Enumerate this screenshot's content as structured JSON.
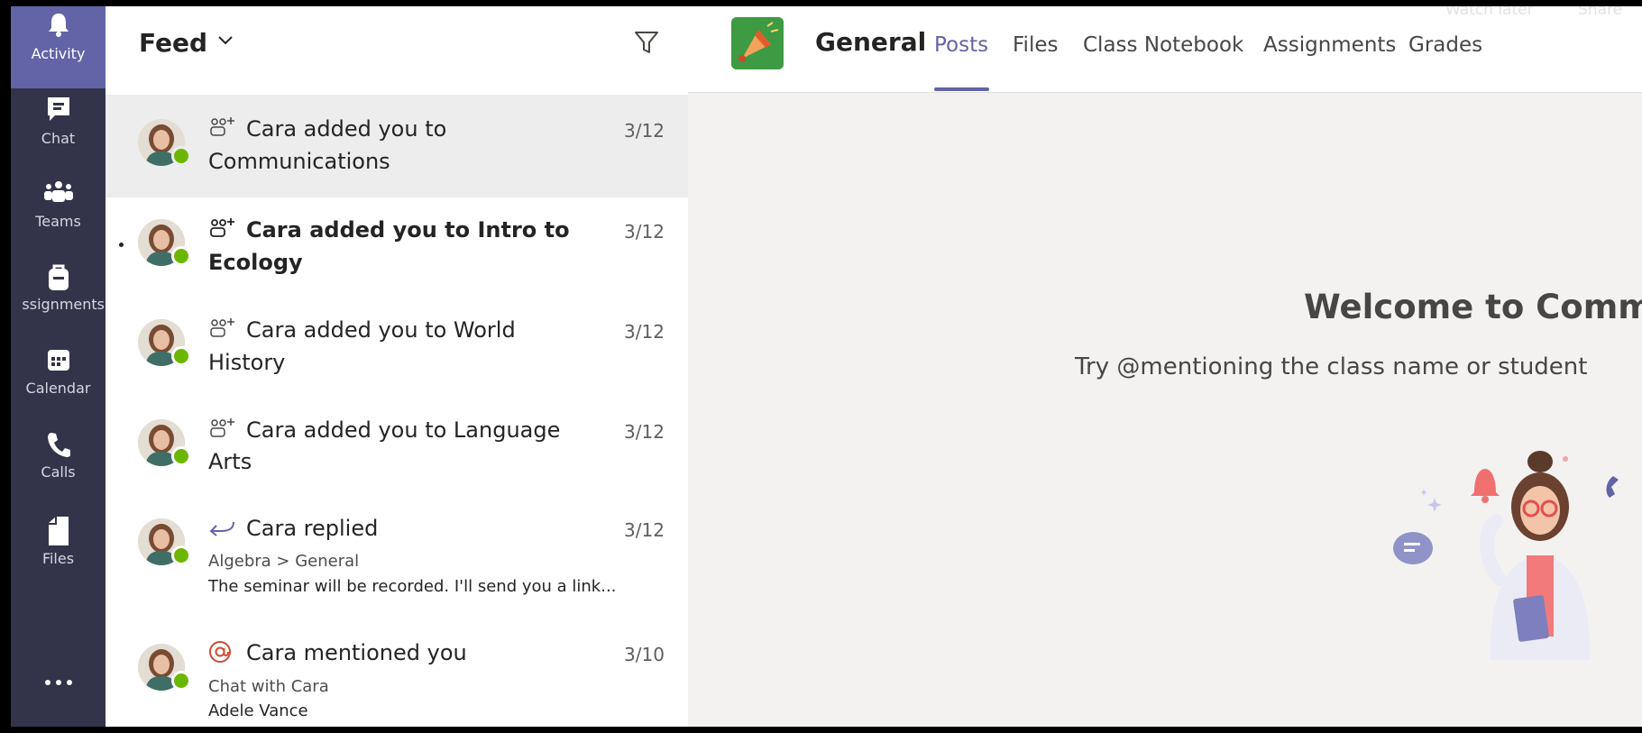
{
  "rail": {
    "items": [
      {
        "label": "Activity",
        "icon": "bell-icon"
      },
      {
        "label": "Chat",
        "icon": "chat-icon"
      },
      {
        "label": "Teams",
        "icon": "teams-icon"
      },
      {
        "label": "ssignments",
        "icon": "assignments-icon"
      },
      {
        "label": "Calendar",
        "icon": "calendar-icon"
      },
      {
        "label": "Calls",
        "icon": "phone-icon"
      },
      {
        "label": "Files",
        "icon": "file-icon"
      },
      {
        "label": "",
        "icon": "more-icon"
      }
    ]
  },
  "feed": {
    "title": "Feed",
    "items": [
      {
        "line1": "Cara added you to",
        "line2": "Communications",
        "date": "3/12"
      },
      {
        "line1": "Cara added you to Intro to",
        "line2": "Ecology",
        "date": "3/12"
      },
      {
        "line1": "Cara added you to World",
        "line2": "History",
        "date": "3/12"
      },
      {
        "line1": "Cara added you to Language",
        "line2": "Arts",
        "date": "3/12"
      },
      {
        "line1": "Cara replied",
        "sub1": "Algebra > General",
        "sub2": "The seminar will be recorded. I'll send you a link...",
        "date": "3/12"
      },
      {
        "line1": "Cara mentioned you",
        "sub1": "Chat with Cara",
        "sub2": "Adele Vance",
        "date": "3/10"
      }
    ]
  },
  "channel": {
    "name": "General",
    "tabs": [
      "Posts",
      "Files",
      "Class Notebook",
      "Assignments",
      "Grades"
    ],
    "overlay": [
      "Watch later",
      "Share"
    ],
    "welcome": "Welcome to Commu",
    "welcome_sub": "Try @mentioning the class name or student"
  },
  "colors": {
    "rail_bg": "#33344a",
    "accent": "#6264a7",
    "presence_available": "#6bb700",
    "channel_logo": "#3e9a43"
  }
}
